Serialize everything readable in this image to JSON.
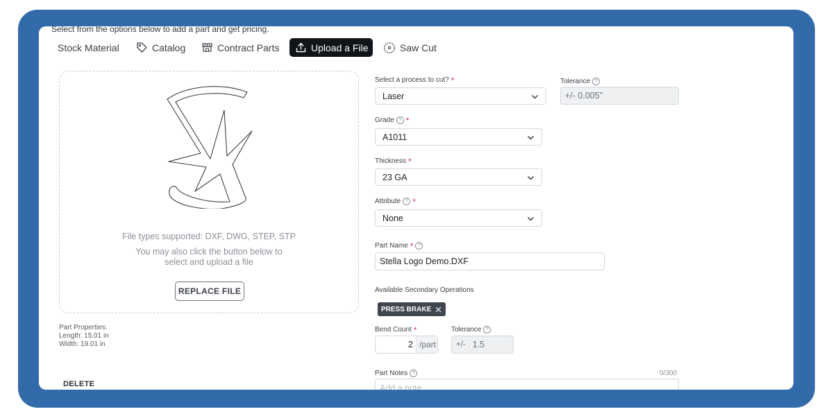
{
  "intro_text": "Select from the options below to add a part and get pricing.",
  "tabs": [
    {
      "label": "Stock Material",
      "icon": "none",
      "active": false
    },
    {
      "label": "Catalog",
      "icon": "tag-icon",
      "active": false
    },
    {
      "label": "Contract Parts",
      "icon": "store-icon",
      "active": false
    },
    {
      "label": "Upload a File",
      "icon": "upload-icon",
      "active": true
    },
    {
      "label": "Saw Cut",
      "icon": "saw-blade-icon",
      "active": false
    }
  ],
  "upload": {
    "file_types": "File types supported: DXF, DWG, STEP, STP",
    "hint_line1": "You may also click the button below to",
    "hint_line2": "select and upload a file",
    "replace_button": "REPLACE FILE"
  },
  "part_properties": {
    "heading": "Part Properties:",
    "length": "Length: 15.01 in",
    "width": "Width: 19.01 in"
  },
  "delete_button": "DELETE",
  "form": {
    "process_label": "Select a process to cut?",
    "process_value": "Laser",
    "tolerance_label": "Tolerance",
    "tolerance_value": "+/- 0.005\"",
    "grade_label": "Grade",
    "grade_value": "A1011",
    "thickness_label": "Thickness",
    "thickness_value": "23 GA",
    "attribute_label": "Attribute",
    "attribute_value": "None",
    "part_name_label": "Part Name",
    "part_name_value": "Stella Logo Demo.DXF",
    "secondary_ops_label": "Available Secondary Operations",
    "secondary_op_chip": "PRESS BRAKE",
    "bend_count_label": "Bend Count",
    "bend_count_value": "2",
    "bend_count_unit": "/part",
    "bend_tolerance_label": "Tolerance",
    "bend_tolerance_prefix": "+/-",
    "bend_tolerance_value": "1.5",
    "part_notes_label": "Part Notes",
    "part_notes_counter": "0/300",
    "part_notes_placeholder": "Add a note..."
  },
  "colors": {
    "frame": "#336aaa",
    "active_tab": "#111418",
    "required": "#d6394f",
    "chip": "#3f4650"
  }
}
